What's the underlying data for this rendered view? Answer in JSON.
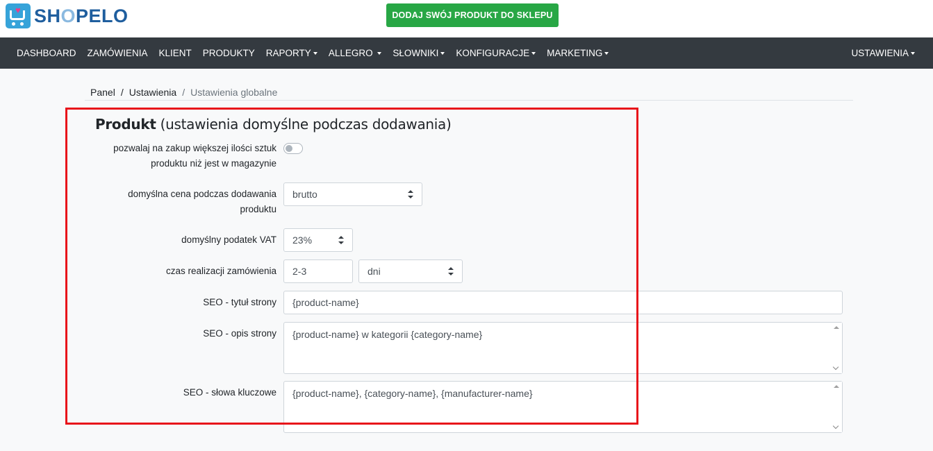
{
  "brand": {
    "name_prefix": "SH",
    "name_o": "O",
    "name_suffix": "PELO"
  },
  "header": {
    "add_product_label": "DODAJ SWÓJ PRODUKT DO SKLEPU"
  },
  "nav": {
    "items": [
      {
        "label": "DASHBOARD",
        "dropdown": false
      },
      {
        "label": "ZAMÓWIENIA",
        "dropdown": false
      },
      {
        "label": "KLIENT",
        "dropdown": false
      },
      {
        "label": "PRODUKTY",
        "dropdown": false
      },
      {
        "label": "RAPORTY",
        "dropdown": true
      },
      {
        "label": "ALLEGRO",
        "dropdown": true
      },
      {
        "label": "SŁOWNIKI",
        "dropdown": true
      },
      {
        "label": "KONFIGURACJE",
        "dropdown": true
      },
      {
        "label": "MARKETING",
        "dropdown": true
      }
    ],
    "right": {
      "label": "USTAWIENIA",
      "dropdown": true
    }
  },
  "breadcrumb": {
    "items": [
      "Panel",
      "Ustawienia"
    ],
    "active": "Ustawienia globalne",
    "separator": "/"
  },
  "section": {
    "title_bold": "Produkt",
    "title_rest": " (ustawienia domyślne podczas dodawania)"
  },
  "form": {
    "allow_overstock": {
      "label_line1": "pozwalaj na zakup większej ilości sztuk",
      "label_line2": "produktu niż jest w magazynie",
      "enabled": false
    },
    "default_price": {
      "label_line1": "domyślna cena podczas dodawania",
      "label_line2": "produktu",
      "value": "brutto"
    },
    "default_vat": {
      "label": "domyślny podatek VAT",
      "value": "23%"
    },
    "fulfillment_time": {
      "label": "czas realizacji zamówienia",
      "value": "2-3",
      "unit": "dni"
    },
    "seo_title": {
      "label": "SEO - tytuł strony",
      "value": "{product-name}"
    },
    "seo_description": {
      "label": "SEO - opis strony",
      "value": "{product-name} w kategorii {category-name}"
    },
    "seo_keywords": {
      "label": "SEO - słowa kluczowe",
      "value": "{product-name}, {category-name}, {manufacturer-name}"
    }
  },
  "colors": {
    "accent_green": "#28a745",
    "navbar": "#343a40",
    "highlight": "#e8131a",
    "brand_blue": "#1f5e9e"
  }
}
